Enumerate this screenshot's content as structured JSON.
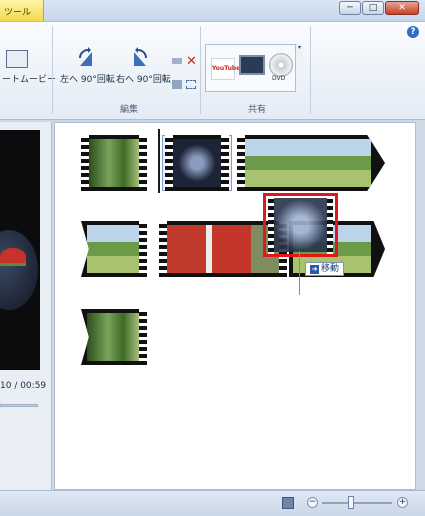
{
  "window": {
    "tools_tab": "ツール",
    "buttons": {
      "minimize": "─",
      "maximize": "□",
      "close": "✕"
    },
    "help": "?"
  },
  "ribbon": {
    "auto_movie_label": "ートムービー",
    "rotate_left_label": "左へ 90°回転",
    "rotate_right_label": "右へ 90°回転",
    "edit_group_label": "編集",
    "share_group_label": "共有",
    "youtube_label": "YouTube",
    "dvd_label": "DVD",
    "share_more": "▾"
  },
  "preview": {
    "time": "10 / 00:59"
  },
  "storyboard": {
    "move_label": "移動",
    "move_icon": "move-arrow-icon"
  },
  "statusbar": {
    "zoom_minus": "−",
    "zoom_plus": "+"
  },
  "colors": {
    "drag_highlight": "#e0181c",
    "accent": "#2f6dc9"
  }
}
